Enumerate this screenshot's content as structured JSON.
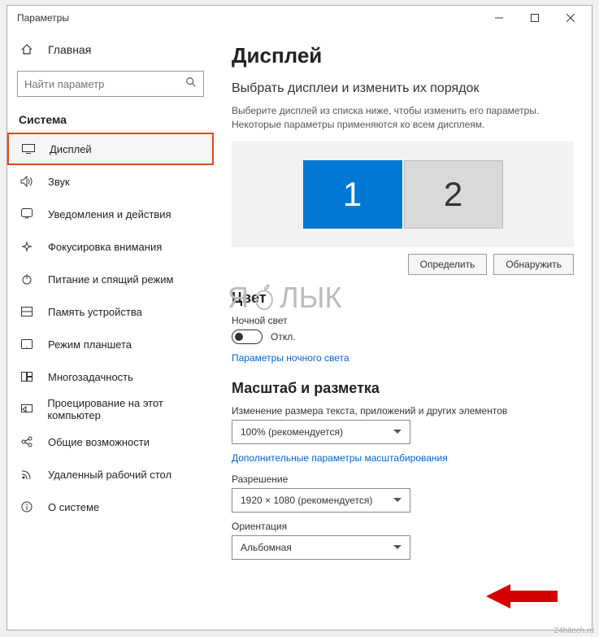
{
  "window": {
    "title": "Параметры"
  },
  "home": {
    "label": "Главная"
  },
  "search": {
    "placeholder": "Найти параметр"
  },
  "section": {
    "label": "Система"
  },
  "sidebar": {
    "items": [
      {
        "label": "Дисплей",
        "selected": true
      },
      {
        "label": "Звук"
      },
      {
        "label": "Уведомления и действия"
      },
      {
        "label": "Фокусировка внимания"
      },
      {
        "label": "Питание и спящий режим"
      },
      {
        "label": "Память устройства"
      },
      {
        "label": "Режим планшета"
      },
      {
        "label": "Многозадачность"
      },
      {
        "label": "Проецирование на этот компьютер"
      },
      {
        "label": "Общие возможности"
      },
      {
        "label": "Удаленный рабочий стол"
      },
      {
        "label": "О системе"
      }
    ]
  },
  "main": {
    "heading": "Дисплей",
    "select_heading": "Выбрать дисплеи и изменить их порядок",
    "select_desc": "Выберите дисплей из списка ниже, чтобы изменить его параметры. Некоторые параметры применяются ко всем дисплеям.",
    "monitors": {
      "primary": "1",
      "secondary": "2"
    },
    "identify_btn": "Определить",
    "detect_btn": "Обнаружить",
    "color_heading": "Цвет",
    "night_light_label": "Ночной свет",
    "night_light_state": "Откл.",
    "night_light_link": "Параметры ночного света",
    "scale_heading": "Масштаб и разметка",
    "scale_label": "Изменение размера текста, приложений и других элементов",
    "scale_value": "100% (рекомендуется)",
    "adv_scale_link": "Дополнительные параметры масштабирования",
    "resolution_label": "Разрешение",
    "resolution_value": "1920 × 1080 (рекомендуется)",
    "orientation_label": "Ориентация",
    "orientation_value": "Альбомная"
  },
  "watermark": {
    "text_left": "Я",
    "text_right": "ЛЫК"
  },
  "credit": "24hitech.ru"
}
